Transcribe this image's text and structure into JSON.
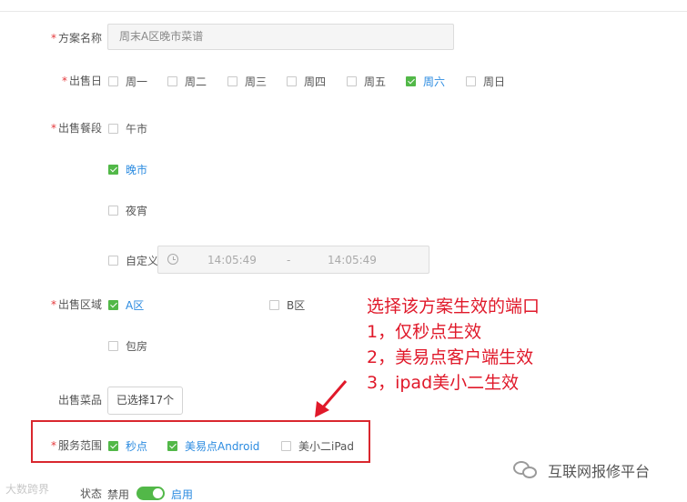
{
  "form": {
    "plan_name": {
      "label": "方案名称",
      "value": "周末A区晚市菜谱"
    },
    "sale_day": {
      "label": "出售日",
      "options": [
        {
          "text": "周一",
          "checked": false
        },
        {
          "text": "周二",
          "checked": false
        },
        {
          "text": "周三",
          "checked": false
        },
        {
          "text": "周四",
          "checked": false
        },
        {
          "text": "周五",
          "checked": false
        },
        {
          "text": "周六",
          "checked": true
        },
        {
          "text": "周日",
          "checked": false
        }
      ]
    },
    "meal_period": {
      "label": "出售餐段",
      "options": [
        {
          "text": "午市",
          "checked": false
        },
        {
          "text": "晚市",
          "checked": true
        },
        {
          "text": "夜宵",
          "checked": false
        },
        {
          "text": "自定义",
          "checked": false
        }
      ],
      "time_start": "14:05:49",
      "time_separator": "-",
      "time_end": "14:05:49"
    },
    "area": {
      "label": "出售区域",
      "options": [
        {
          "text": "A区",
          "checked": true
        },
        {
          "text": "B区",
          "checked": false
        },
        {
          "text": "包房",
          "checked": false
        }
      ]
    },
    "dishes": {
      "label": "出售菜品",
      "button": "已选择17个"
    },
    "service_scope": {
      "label": "服务范围",
      "options": [
        {
          "text": "秒点",
          "checked": true
        },
        {
          "text": "美易点Android",
          "checked": true
        },
        {
          "text": "美小二iPad",
          "checked": false
        }
      ]
    },
    "status": {
      "label": "状态",
      "off_text": "禁用",
      "on_text": "启用",
      "enabled": true
    }
  },
  "annotation": {
    "lines": [
      "选择该方案生效的端口",
      "1，仅秒点生效",
      "2，美易点客户端生效",
      "3，ipad美小二生效"
    ],
    "color": "#e0192a"
  },
  "watermark": {
    "left": "大数跨界",
    "right": "互联网报修平台"
  },
  "colors": {
    "accent": "#2b8be0",
    "check": "#52b848",
    "required": "#e4393c"
  }
}
